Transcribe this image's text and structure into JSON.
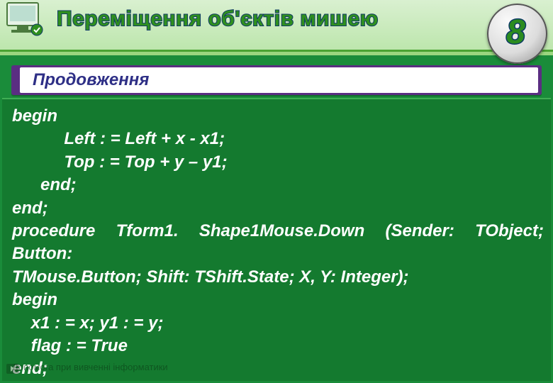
{
  "header": {
    "title": "Переміщення об'єктів мишею"
  },
  "badge": {
    "number": "8"
  },
  "subheader": {
    "label": "Продовження"
  },
  "code": {
    "l1": "begin",
    "l2": "           Left : = Left + x - x1;",
    "l3": "           Top : = Top + y – y1;",
    "l4": "      end;",
    "l5": "end;",
    "l6": "procedure   Tform1. Shape1Mouse.Down   (Sender: TObject; Button:",
    "l7": "TMouse.Button; Shift: TShift.State; X, Y: Integer);",
    "l8": "begin",
    "l9": "    x1 : = x; y1 : = y;",
    "l10": "    flag : = True",
    "l11": "end;"
  },
  "footer": {
    "text": "Допомога при вивченні інформатики"
  }
}
